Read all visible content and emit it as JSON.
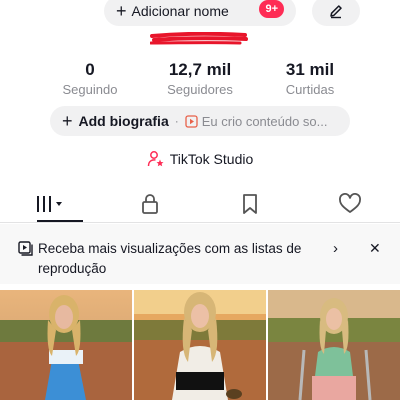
{
  "header": {
    "add_name_label": "Adicionar nome",
    "notification_badge": "9+",
    "edit_icon": "pencil-icon"
  },
  "stats": [
    {
      "value": "0",
      "label": "Seguindo"
    },
    {
      "value": "12,7 mil",
      "label": "Seguidores"
    },
    {
      "value": "31 mil",
      "label": "Curtidas"
    }
  ],
  "bio": {
    "add_label": "Add biografia",
    "hint": "Eu crio conteúdo so..."
  },
  "studio": {
    "label": "TikTok Studio"
  },
  "tabs": [
    "videos-grid-icon",
    "lock-icon",
    "bookmark-icon",
    "heart-icon"
  ],
  "banner": {
    "text": "Receba mais visualizações com as listas de reprodução"
  },
  "colors": {
    "badge": "#fe2c55",
    "redaction": "#e8152b",
    "muted_text": "#8a8b91"
  }
}
